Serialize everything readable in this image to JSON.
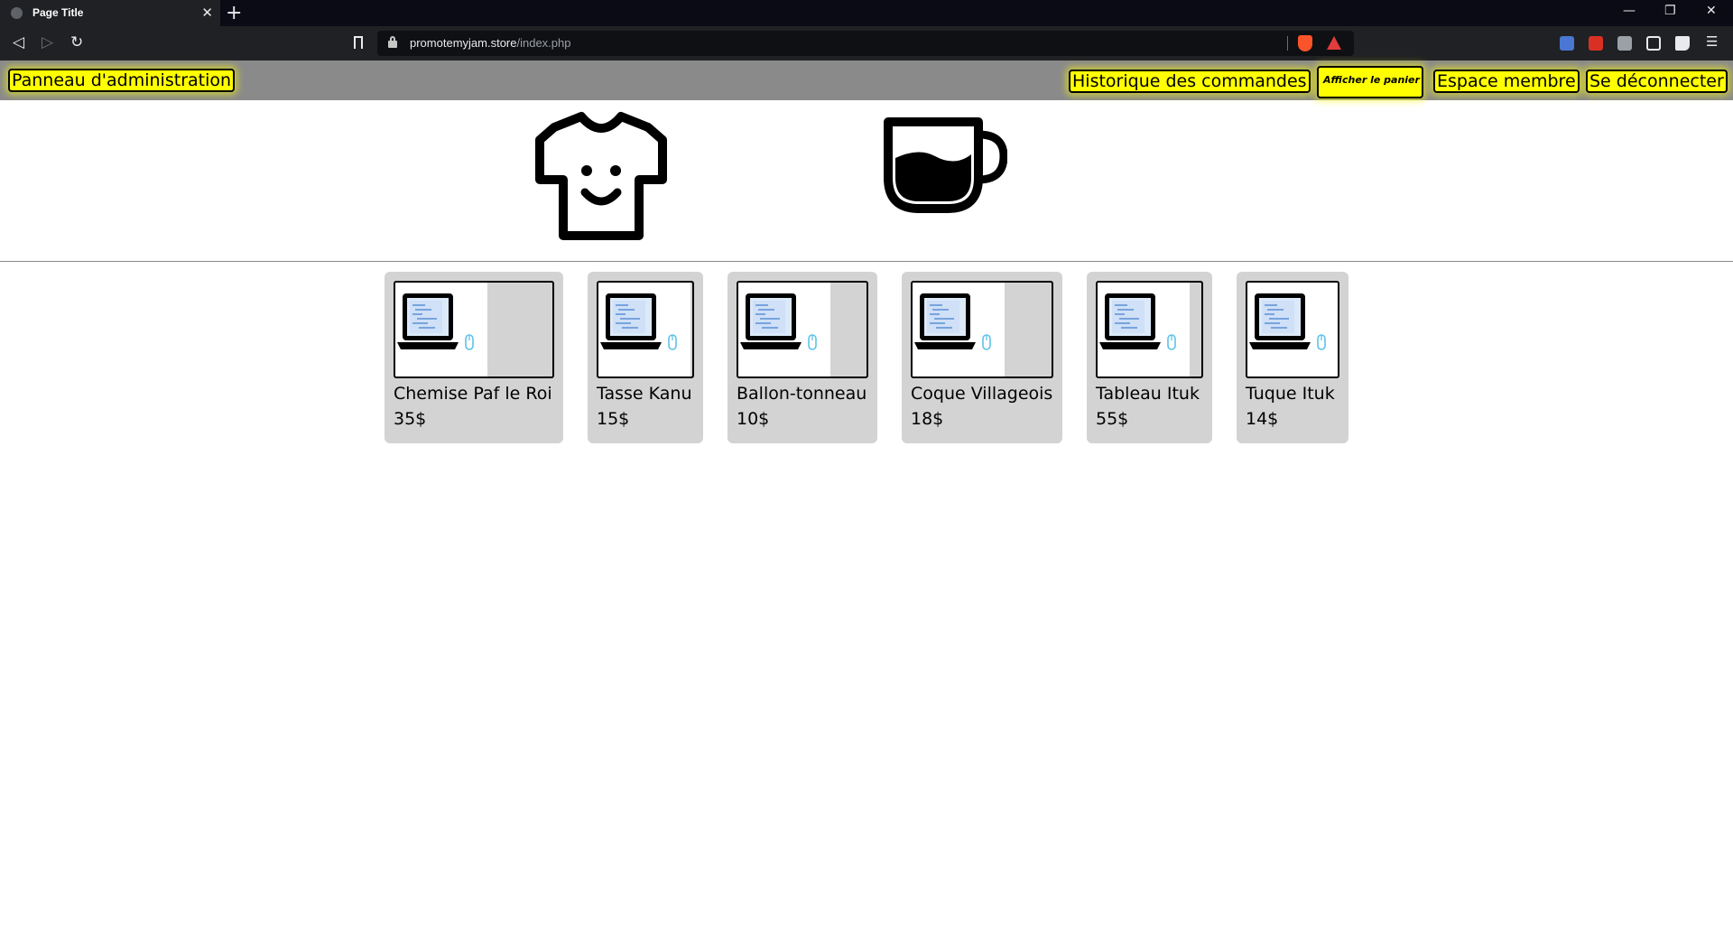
{
  "browser": {
    "tab_title": "Page Title",
    "tab_close": "✕",
    "new_tab": "+",
    "url_host": "promotemyjam.store",
    "url_path": "/index.php",
    "window_controls": [
      "—",
      "❐",
      "✕"
    ]
  },
  "nav": {
    "admin_label": "Panneau d'administration",
    "orders_label": "Historique des commandes",
    "cart_label": "Afficher le panier",
    "member_label": "Espace membre",
    "logout_label": "Se déconnecter",
    "highlight_color": "#ffff00"
  },
  "categories": [
    {
      "icon": "tshirt-icon"
    },
    {
      "icon": "coffee-cup-icon"
    }
  ],
  "products": [
    {
      "name": "Chemise Paf le Roi",
      "price": "35$"
    },
    {
      "name": "Tasse Kanu",
      "price": "15$"
    },
    {
      "name": "Ballon-tonneau",
      "price": "10$"
    },
    {
      "name": "Coque Villageois",
      "price": "18$"
    },
    {
      "name": "Tableau Ituk",
      "price": "55$"
    },
    {
      "name": "Tuque Ituk",
      "price": "14$"
    }
  ]
}
